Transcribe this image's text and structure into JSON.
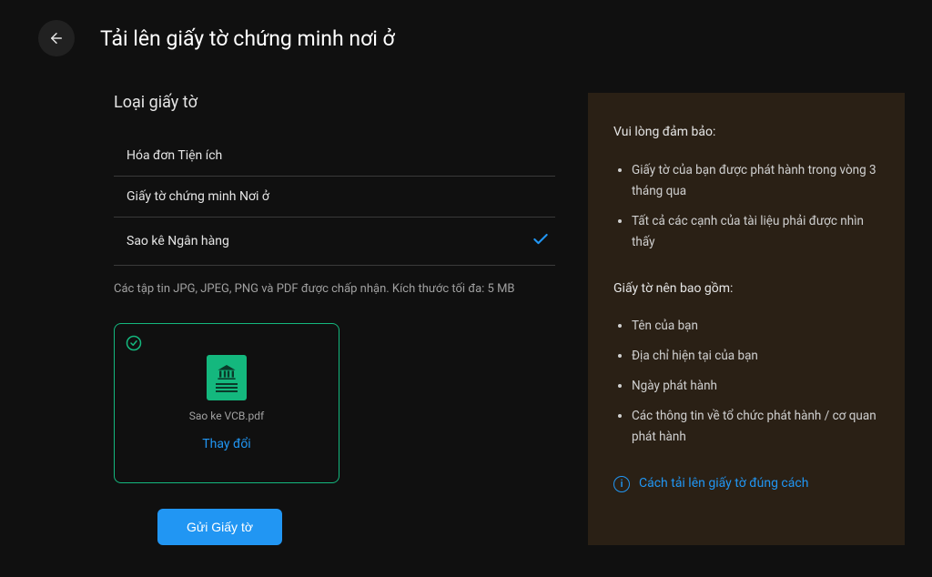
{
  "header": {
    "title": "Tải lên giấy tờ chứng minh nơi ở"
  },
  "left": {
    "section_heading": "Loại giấy tờ",
    "options": [
      {
        "label": "Hóa đơn Tiện ích",
        "selected": false
      },
      {
        "label": "Giấy tờ chứng minh Nơi ở",
        "selected": false
      },
      {
        "label": "Sao kê Ngân hàng",
        "selected": true
      }
    ],
    "hint": "Các tập tin JPG, JPEG, PNG và PDF được chấp nhận. Kích thước tối đa: 5 MB",
    "upload": {
      "file_name": "Sao ke VCB.pdf",
      "change_label": "Thay đổi"
    },
    "submit_label": "Gửi Giấy tờ"
  },
  "info": {
    "ensure_heading": "Vui lòng đảm bảo:",
    "ensure_items": [
      "Giấy tờ của bạn được phát hành trong vòng 3 tháng qua",
      "Tất cả các cạnh của tài liệu phải được nhìn thấy"
    ],
    "include_heading": "Giấy tờ nên bao gồm:",
    "include_items": [
      "Tên của bạn",
      "Địa chỉ hiện tại của bạn",
      "Ngày phát hành",
      "Các thông tin về tổ chức phát hành / cơ quan phát hành"
    ],
    "help_link": "Cách tải lên giấy tờ đúng cách"
  }
}
